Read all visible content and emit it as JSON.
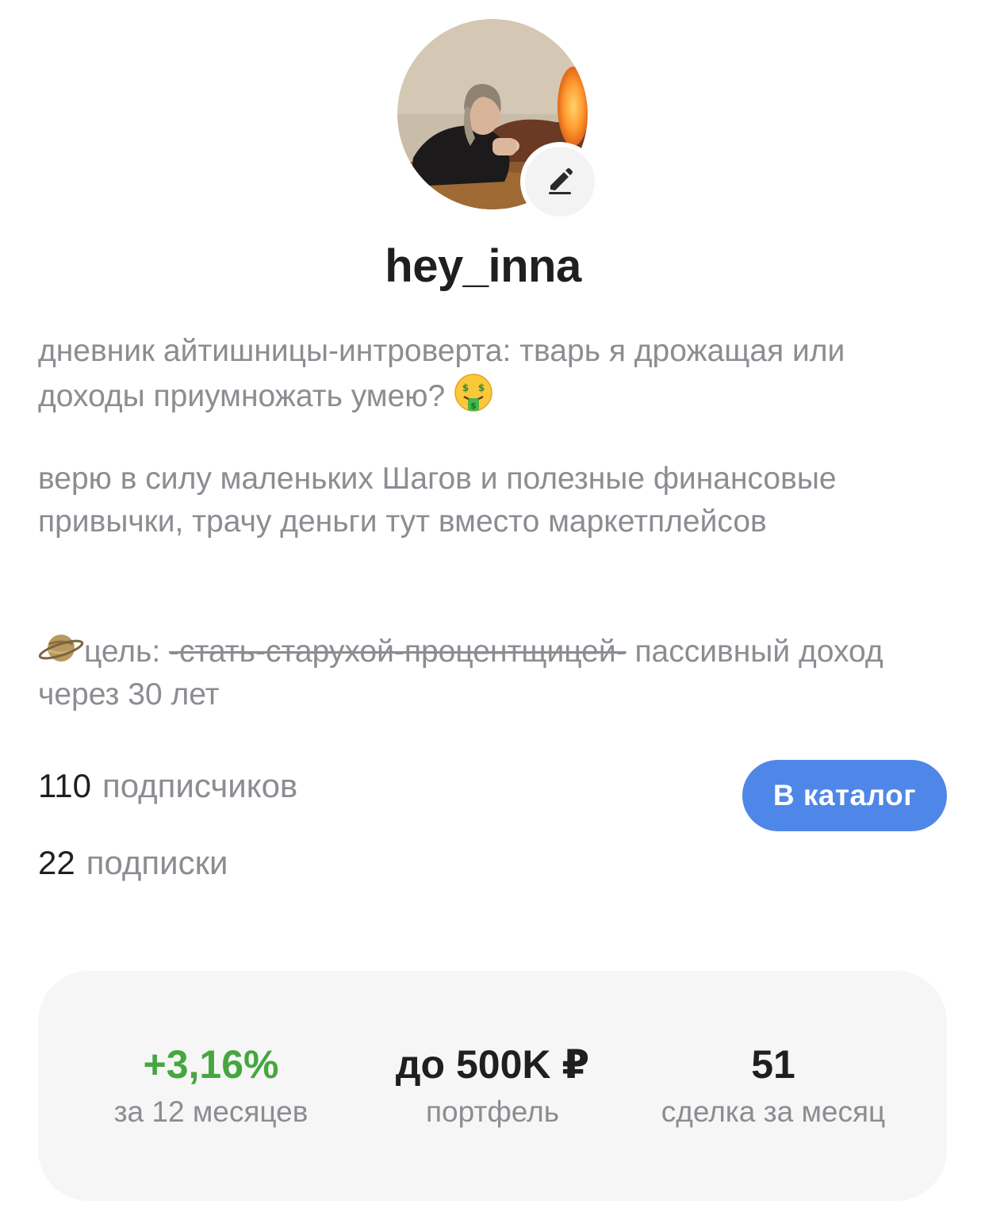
{
  "profile": {
    "username": "hey_inna",
    "avatar_icon": "user-photo",
    "edit_icon": "pencil-icon"
  },
  "bio": {
    "p1": "дневник айтишницы-интроверта: тварь я дрожащая или доходы приумножать умею?",
    "p1_emoji": "money-mouth-face-emoji",
    "p2": "верю в силу маленьких Шагов и полезные финансовые привычки, трачу деньги тут вместо маркетплейсов",
    "p3_emoji": "ringed-planet-emoji",
    "p3_label": "цель:",
    "p3_strike": "-стать-старухой-процентщицей-",
    "p3_rest": "пассивный доход через 30 лет"
  },
  "counts": {
    "followers_num": "110",
    "followers_label": "подписчиков",
    "following_num": "22",
    "following_label": "подписки"
  },
  "actions": {
    "catalog_label": "В каталог"
  },
  "stats": {
    "return_value": "+3,16%",
    "return_label": "за 12 месяцев",
    "portfolio_value": "до 500K ₽",
    "portfolio_label": "портфель",
    "deals_value": "51",
    "deals_label": "сделка за месяц"
  },
  "colors": {
    "accent": "#4f87e9",
    "positive": "#47a63f",
    "secondary_text": "#8c8c92",
    "card_bg": "#f6f6f6"
  }
}
